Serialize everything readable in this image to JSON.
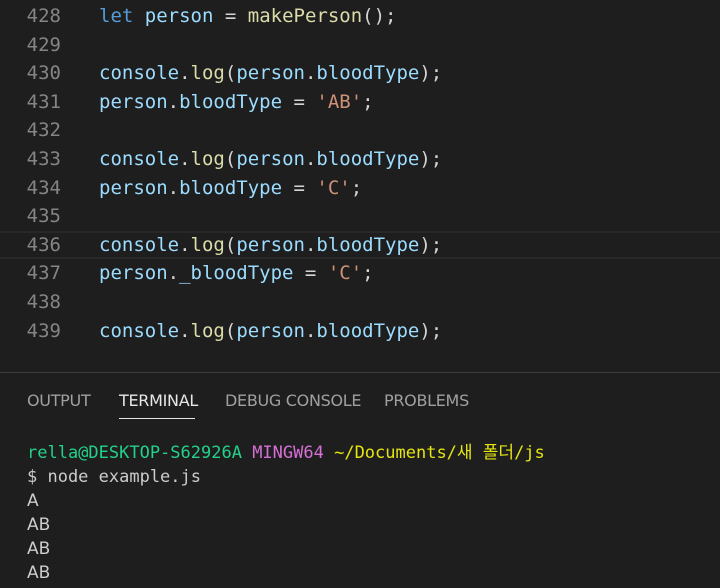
{
  "editor": {
    "lines": [
      {
        "number": "428",
        "tokens": [
          {
            "text": "let",
            "type": "keyword"
          },
          {
            "text": " ",
            "type": "punct"
          },
          {
            "text": "person",
            "type": "var"
          },
          {
            "text": " = ",
            "type": "punct"
          },
          {
            "text": "makePerson",
            "type": "func"
          },
          {
            "text": "();",
            "type": "punct"
          }
        ]
      },
      {
        "number": "429",
        "tokens": []
      },
      {
        "number": "430",
        "tokens": [
          {
            "text": "console",
            "type": "var"
          },
          {
            "text": ".",
            "type": "punct"
          },
          {
            "text": "log",
            "type": "func"
          },
          {
            "text": "(",
            "type": "punct"
          },
          {
            "text": "person",
            "type": "var"
          },
          {
            "text": ".",
            "type": "punct"
          },
          {
            "text": "bloodType",
            "type": "var"
          },
          {
            "text": ");",
            "type": "punct"
          }
        ]
      },
      {
        "number": "431",
        "tokens": [
          {
            "text": "person",
            "type": "var"
          },
          {
            "text": ".",
            "type": "punct"
          },
          {
            "text": "bloodType",
            "type": "var"
          },
          {
            "text": " = ",
            "type": "punct"
          },
          {
            "text": "'AB'",
            "type": "string"
          },
          {
            "text": ";",
            "type": "punct"
          }
        ]
      },
      {
        "number": "432",
        "tokens": []
      },
      {
        "number": "433",
        "tokens": [
          {
            "text": "console",
            "type": "var"
          },
          {
            "text": ".",
            "type": "punct"
          },
          {
            "text": "log",
            "type": "func"
          },
          {
            "text": "(",
            "type": "punct"
          },
          {
            "text": "person",
            "type": "var"
          },
          {
            "text": ".",
            "type": "punct"
          },
          {
            "text": "bloodType",
            "type": "var"
          },
          {
            "text": ");",
            "type": "punct"
          }
        ]
      },
      {
        "number": "434",
        "tokens": [
          {
            "text": "person",
            "type": "var"
          },
          {
            "text": ".",
            "type": "punct"
          },
          {
            "text": "bloodType",
            "type": "var"
          },
          {
            "text": " = ",
            "type": "punct"
          },
          {
            "text": "'C'",
            "type": "string"
          },
          {
            "text": ";",
            "type": "punct"
          }
        ]
      },
      {
        "number": "435",
        "tokens": []
      },
      {
        "number": "436",
        "current": true,
        "tokens": [
          {
            "text": "console",
            "type": "var"
          },
          {
            "text": ".",
            "type": "punct"
          },
          {
            "text": "log",
            "type": "func"
          },
          {
            "text": "(",
            "type": "punct"
          },
          {
            "text": "person",
            "type": "var"
          },
          {
            "text": ".",
            "type": "punct"
          },
          {
            "text": "bloodType",
            "type": "var"
          },
          {
            "text": ");",
            "type": "punct"
          }
        ]
      },
      {
        "number": "437",
        "tokens": [
          {
            "text": "person",
            "type": "var"
          },
          {
            "text": ".",
            "type": "punct"
          },
          {
            "text": "_bloodType",
            "type": "var"
          },
          {
            "text": " = ",
            "type": "punct"
          },
          {
            "text": "'C'",
            "type": "string"
          },
          {
            "text": ";",
            "type": "punct"
          }
        ]
      },
      {
        "number": "438",
        "tokens": []
      },
      {
        "number": "439",
        "tokens": [
          {
            "text": "console",
            "type": "var"
          },
          {
            "text": ".",
            "type": "punct"
          },
          {
            "text": "log",
            "type": "func"
          },
          {
            "text": "(",
            "type": "punct"
          },
          {
            "text": "person",
            "type": "var"
          },
          {
            "text": ".",
            "type": "punct"
          },
          {
            "text": "bloodType",
            "type": "var"
          },
          {
            "text": ");",
            "type": "punct"
          }
        ]
      }
    ]
  },
  "panel": {
    "tabs": [
      {
        "label": "OUTPUT",
        "active": false
      },
      {
        "label": "TERMINAL",
        "active": true
      },
      {
        "label": "DEBUG CONSOLE",
        "active": false
      },
      {
        "label": "PROBLEMS",
        "active": false
      }
    ]
  },
  "terminal": {
    "prompt": {
      "user_host": "rella@DESKTOP-S62926A",
      "system": "MINGW64",
      "path": "~/Documents/새 폴더/js"
    },
    "command_line": "$ node example.js",
    "output": [
      "A",
      "AB",
      "AB",
      "AB"
    ]
  },
  "colors": {
    "background": "#1e1e1e",
    "keyword": "#569cd6",
    "variable": "#9cdcfe",
    "function": "#dcdcaa",
    "string": "#ce9178",
    "line_number": "#858585",
    "terminal_green": "#23d18b",
    "terminal_magenta": "#d670d6",
    "terminal_yellow": "#e5e510"
  }
}
